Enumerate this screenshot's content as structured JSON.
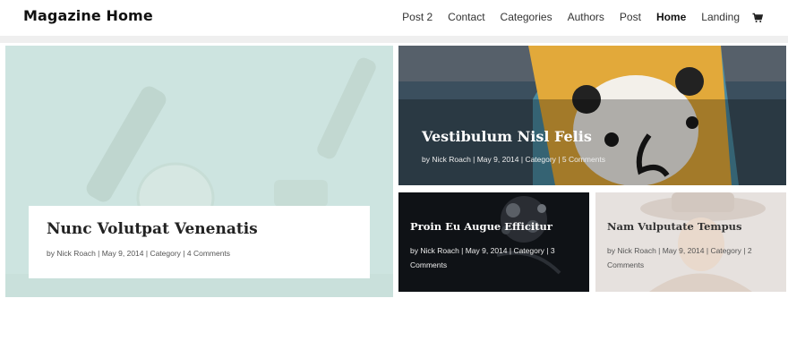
{
  "site": {
    "logo": "Magazine Home"
  },
  "nav": {
    "items": [
      {
        "label": "Post 2"
      },
      {
        "label": "Contact"
      },
      {
        "label": "Categories"
      },
      {
        "label": "Authors"
      },
      {
        "label": "Post"
      },
      {
        "label": "Home",
        "active": true
      },
      {
        "label": "Landing"
      }
    ],
    "cart_icon": "cart-icon"
  },
  "posts": [
    {
      "title": "Nunc Volutpat Venenatis",
      "meta": "by Nick Roach | May 9, 2014 | Category | 4 Comments"
    },
    {
      "title": "Vestibulum Nisl Felis",
      "meta": "by Nick Roach | May 9, 2014 | Category | 5 Comments"
    },
    {
      "title": "Proin Eu Augue Efficitur",
      "meta": "by Nick Roach | May 9, 2014 | Category | 3 Comments"
    },
    {
      "title": "Nam Vulputate Tempus",
      "meta": "by Nick Roach | May 9, 2014 | Category | 2 Comments"
    }
  ],
  "colors": {
    "card_a_bg": "#cde4e0",
    "card_b_bg": "#3b4f5e",
    "card_b_pillow": "#e2a93a",
    "card_c_bg": "#0f1216",
    "card_d_bg": "#e6e1de"
  }
}
